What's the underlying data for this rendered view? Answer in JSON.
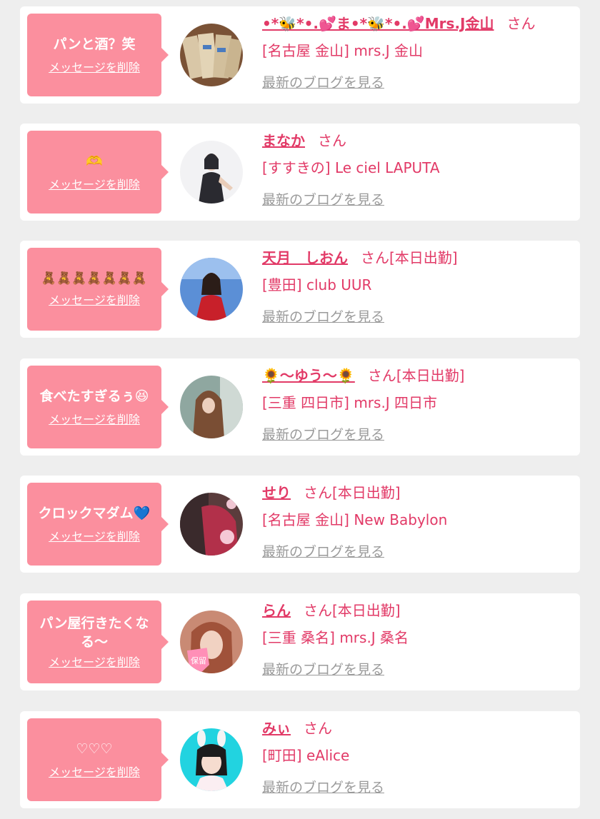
{
  "messages": [
    {
      "bubble_text": "パンと酒？笑",
      "delete_label": "メッセージを削除",
      "name": "•*🐝*•.💕ま•*🐝*•.💕Mrs.J金山",
      "honorific": "さん",
      "status": "",
      "shop": "[名古屋 金山] mrs.J 金山",
      "blog_label": "最新のブログを見る",
      "avatar_icon": "bread-photo-avatar",
      "avatar_colors": [
        "#7a5236",
        "#d9c7a7"
      ]
    },
    {
      "bubble_text": "🫶",
      "delete_label": "メッセージを削除",
      "name": "まなか",
      "honorific": "さん",
      "status": "",
      "shop": "[すすきの] Le ciel LAPUTA",
      "blog_label": "最新のブログを見る",
      "avatar_icon": "woman-photo-avatar",
      "avatar_colors": [
        "#f2f2f4",
        "#2a2a30"
      ]
    },
    {
      "bubble_text": "🧸🧸🧸🧸🧸🧸🧸",
      "delete_label": "メッセージを削除",
      "name": "天月　しおん",
      "honorific": "さん",
      "status": "[本日出勤]",
      "shop": "[豊田] club UUR",
      "blog_label": "最新のブログを見る",
      "avatar_icon": "woman-photo-avatar",
      "avatar_colors": [
        "#5b8fd6",
        "#c8202a"
      ]
    },
    {
      "bubble_text": "食べたすぎるぅ😆",
      "delete_label": "メッセージを削除",
      "name": "🌻～ゆう～🌻",
      "honorific": "さん",
      "status": "[本日出勤]",
      "shop": "[三重 四日市] mrs.J 四日市",
      "blog_label": "最新のブログを見る",
      "avatar_icon": "woman-photo-avatar",
      "avatar_colors": [
        "#8fa7a0",
        "#7a4e34"
      ]
    },
    {
      "bubble_text": "クロックマダム💙",
      "delete_label": "メッセージを削除",
      "name": "せり",
      "honorific": "さん",
      "status": "[本日出勤]",
      "shop": "[名古屋 金山] New Babylon",
      "blog_label": "最新のブログを見る",
      "avatar_icon": "woman-photo-avatar",
      "avatar_colors": [
        "#5a3c3c",
        "#b2304a"
      ]
    },
    {
      "bubble_text": "パン屋行きたくなる～",
      "delete_label": "メッセージを削除",
      "name": "らん",
      "honorific": "さん",
      "status": "[本日出勤]",
      "shop": "[三重 桑名] mrs.J 桑名",
      "blog_label": "最新のブログを見る",
      "avatar_icon": "woman-photo-avatar",
      "avatar_colors": [
        "#a0523a",
        "#ff8fb7"
      ],
      "avatar_sticker": "保留"
    },
    {
      "bubble_text": "♡♡♡",
      "delete_label": "メッセージを削除",
      "name": "みぃ",
      "honorific": "さん",
      "status": "",
      "shop": "[町田] eAlice",
      "blog_label": "最新のブログを見る",
      "avatar_icon": "woman-photo-avatar",
      "avatar_colors": [
        "#22d3e0",
        "#1c1c1c"
      ]
    }
  ]
}
